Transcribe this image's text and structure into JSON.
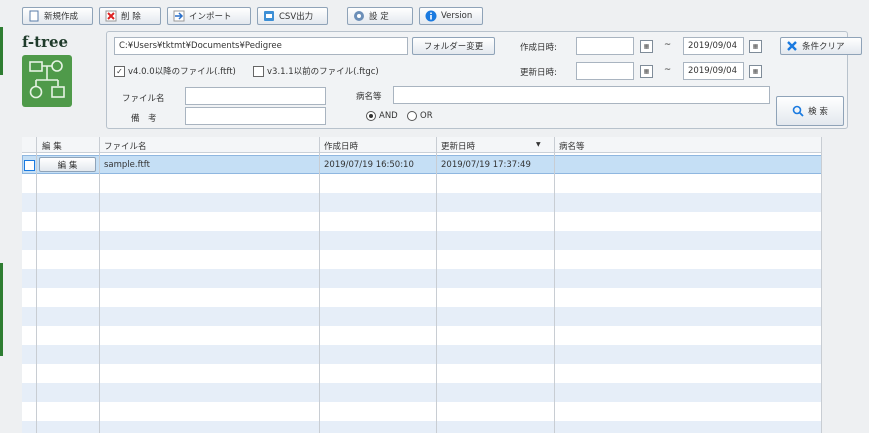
{
  "toolbar": {
    "new_label": "新規作成",
    "delete_label": "削 除",
    "import_label": "インポート",
    "csv_label": "CSV出力",
    "settings_label": "設 定",
    "version_label": "Version"
  },
  "logo": {
    "text": "f-tree"
  },
  "search": {
    "folder_path": "C:¥Users¥tktmt¥Documents¥Pedigree",
    "folder_change_label": "フォルダー変更",
    "created_label": "作成日時:",
    "updated_label": "更新日時:",
    "created_from": "",
    "created_to": "2019/09/04",
    "updated_from": "",
    "updated_to": "2019/09/04",
    "tilde": "~",
    "clear_label": "条件クリア",
    "checkbox_v4_label": "v4.0.0以降のファイル(.ftft)",
    "checkbox_v3_label": "v3.1.1以前のファイル(.ftgc)",
    "filename_label": "ファイル名",
    "filename_value": "",
    "note_label": "備　考",
    "note_value": "",
    "disease_label": "病名等",
    "disease_value": "",
    "and_label": "AND",
    "or_label": "OR",
    "search_label": "検 索"
  },
  "table": {
    "headers": [
      "編 集",
      "ファイル名",
      "作成日時",
      "更新日時",
      "病名等"
    ],
    "sort_indicator": "▼",
    "rows": [
      {
        "edit": "編 集",
        "filename": "sample.ftft",
        "created": "2019/07/19 16:50:10",
        "updated": "2019/07/19 17:37:49",
        "disease": ""
      }
    ]
  },
  "colors": {
    "accent": "#1a7ae0",
    "selected_row": "#c5dff5",
    "stripe": "#e6eef8",
    "logo_bg": "#4f9a4a"
  }
}
